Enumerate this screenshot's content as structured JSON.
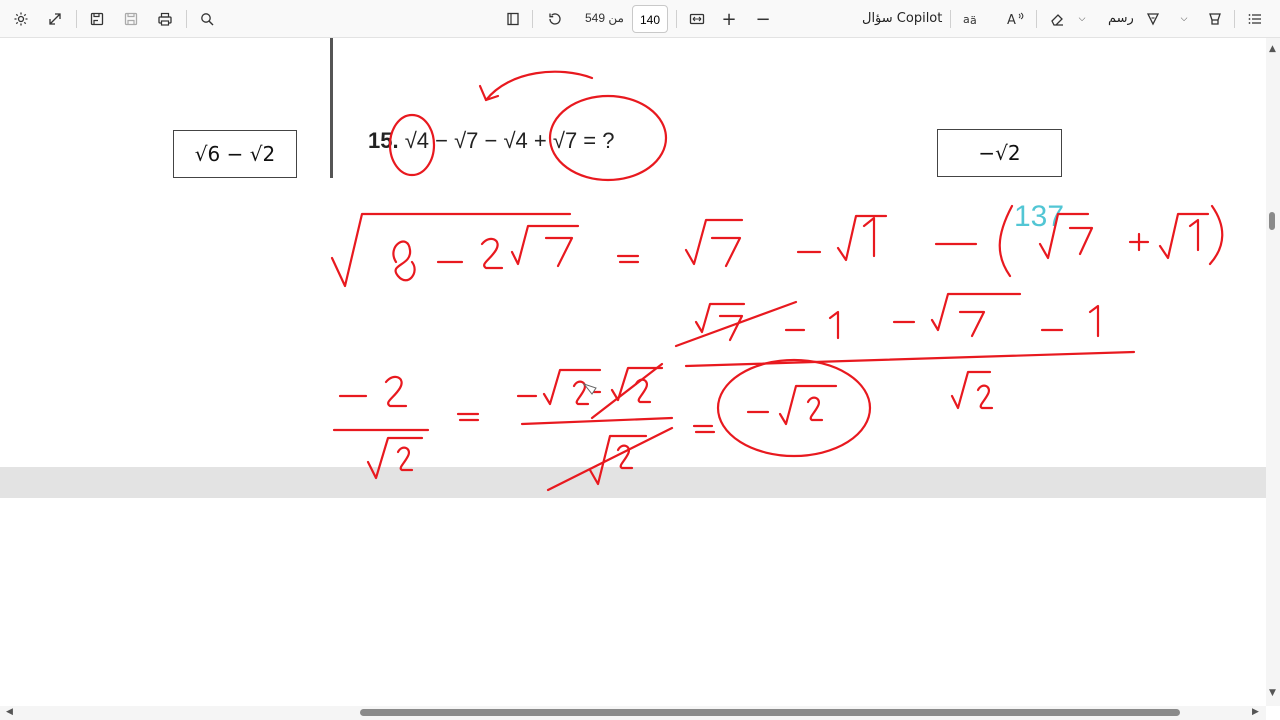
{
  "toolbar": {
    "page_current": "140",
    "page_total": "من 549",
    "copilot_label": "سؤال Copilot",
    "draw_label": "رسم",
    "icons": [
      "settings-icon",
      "expand-icon",
      "save-as-icon",
      "save-icon",
      "print-icon",
      "search-icon",
      "page-fit-icon",
      "rotate-icon",
      "fit-width-icon",
      "zoom-in-icon",
      "zoom-out-icon",
      "translate-icon",
      "read-aloud-icon",
      "erase-icon",
      "chevron-down-icon",
      "draw-icon",
      "chevron-down-icon",
      "highlight-icon",
      "contents-icon"
    ]
  },
  "document": {
    "question_number": "15.",
    "question_expression": "√4 − √7 − √4 + √7 = ?",
    "answer_left": "√6 − √2",
    "answer_right": "−√2",
    "page_overlay_number": "137"
  },
  "colors": {
    "ink": "#e8191f",
    "overlay_number": "#40c0d0"
  }
}
